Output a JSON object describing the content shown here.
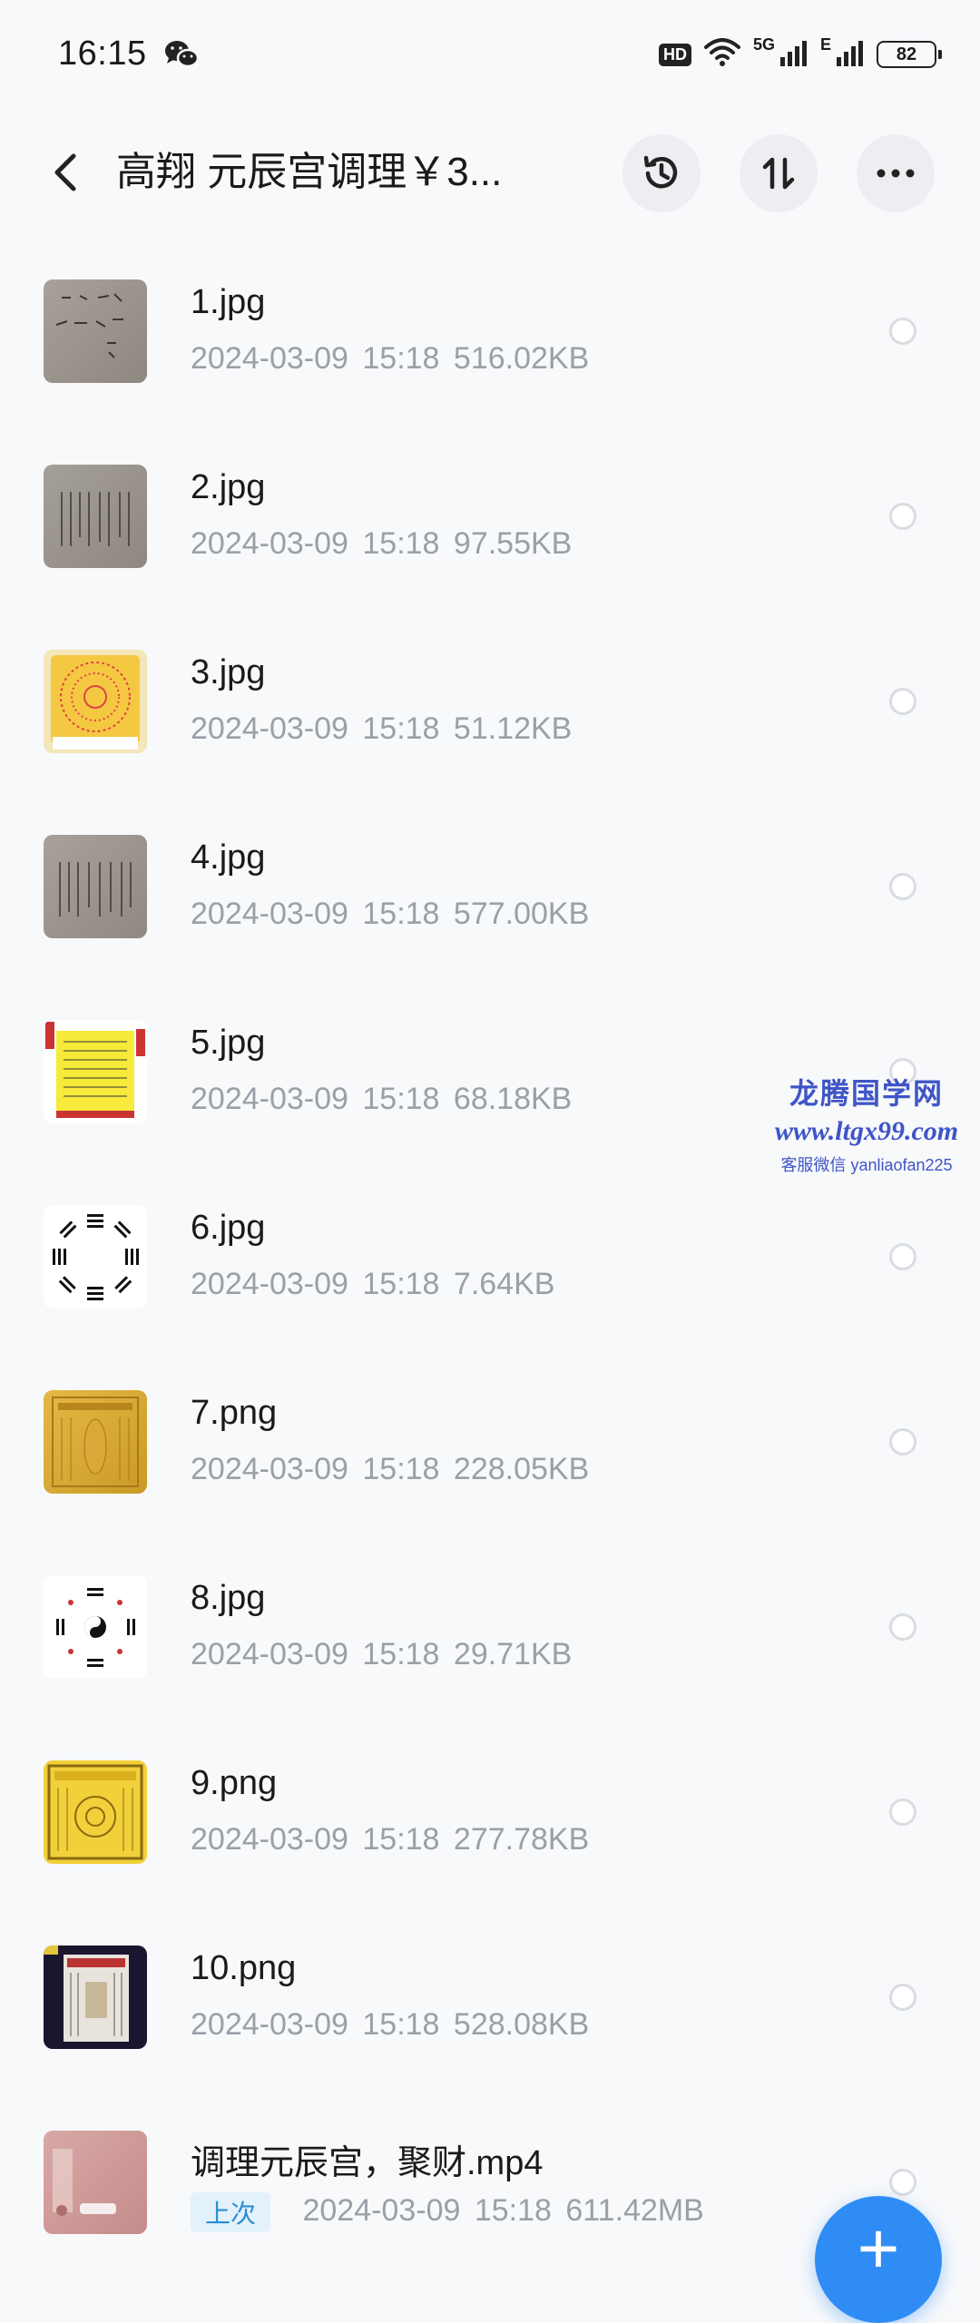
{
  "status_bar": {
    "time": "16:15",
    "hd": "HD",
    "net1": "5G",
    "net2": "E",
    "battery": "82"
  },
  "header": {
    "title": "高翔 元辰宫调理￥3...",
    "icons": [
      "back-icon",
      "history-icon",
      "sort-icon",
      "more-icon"
    ]
  },
  "files": [
    {
      "name": "1.jpg",
      "date": "2024-03-09",
      "time": "15:18",
      "size": "516.02KB",
      "badge": ""
    },
    {
      "name": "2.jpg",
      "date": "2024-03-09",
      "time": "15:18",
      "size": "97.55KB",
      "badge": ""
    },
    {
      "name": "3.jpg",
      "date": "2024-03-09",
      "time": "15:18",
      "size": "51.12KB",
      "badge": ""
    },
    {
      "name": "4.jpg",
      "date": "2024-03-09",
      "time": "15:18",
      "size": "577.00KB",
      "badge": ""
    },
    {
      "name": "5.jpg",
      "date": "2024-03-09",
      "time": "15:18",
      "size": "68.18KB",
      "badge": ""
    },
    {
      "name": "6.jpg",
      "date": "2024-03-09",
      "time": "15:18",
      "size": "7.64KB",
      "badge": ""
    },
    {
      "name": "7.png",
      "date": "2024-03-09",
      "time": "15:18",
      "size": "228.05KB",
      "badge": ""
    },
    {
      "name": "8.jpg",
      "date": "2024-03-09",
      "time": "15:18",
      "size": "29.71KB",
      "badge": ""
    },
    {
      "name": "9.png",
      "date": "2024-03-09",
      "time": "15:18",
      "size": "277.78KB",
      "badge": ""
    },
    {
      "name": "10.png",
      "date": "2024-03-09",
      "time": "15:18",
      "size": "528.08KB",
      "badge": ""
    },
    {
      "name": "调理元辰宫，聚财.mp4",
      "date": "2024-03-09",
      "time": "15:18",
      "size": "611.42MB",
      "badge": "上次"
    }
  ],
  "watermark": {
    "line1": "龙腾国学网",
    "line2": "www.ltgx99.com",
    "line3": "客服微信 yanliaofan225"
  },
  "fab": {
    "label": "+"
  },
  "colors": {
    "accent": "#2f8cf4",
    "meta_text": "#9aa0a8",
    "watermark": "#3f55c7"
  }
}
